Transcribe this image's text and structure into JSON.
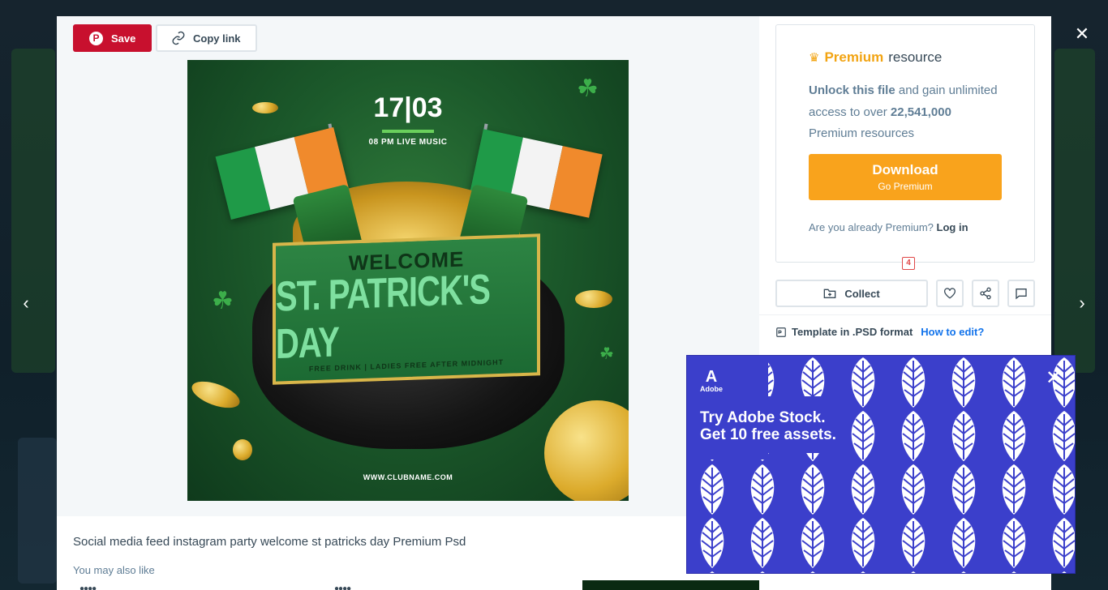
{
  "nav": {
    "prev_icon": "‹",
    "next_icon": "›",
    "close_icon": "✕"
  },
  "toolbar": {
    "save_label": "Save",
    "pin_glyph": "P",
    "copy_label": "Copy link"
  },
  "preview": {
    "date": "17|03",
    "time": "08 PM LIVE MUSIC",
    "welcome": "WELCOME",
    "title": "ST. PATRICK'S DAY",
    "subtitle": "FREE DRINK | LADIES FREE AFTER MIDNIGHT",
    "website": "WWW.CLUBNAME.COM"
  },
  "caption": "Social media feed instagram party welcome st patricks day Premium Psd",
  "also_like": "You may also like",
  "premium": {
    "crown_icon": "♛",
    "prem_word": "Premium",
    "resource_word": "resource",
    "unlock_bold": "Unlock this file",
    "unlock_rest": "and gain unlimited access to over",
    "count": "22,541,000",
    "count_rest": "Premium resources",
    "download_label": "Download",
    "download_sub": "Go Premium",
    "already_text": "Are you already Premium?",
    "login_label": "Log in"
  },
  "actions": {
    "collect_label": "Collect",
    "like_count": "4"
  },
  "template": {
    "label": "Template in .PSD format",
    "how_to": "How to edit?"
  },
  "ad": {
    "brand": "Adobe",
    "logo_glyph": "A",
    "line1": "Try Adobe Stock.",
    "line2": "Get 10 free assets.",
    "close_icon": "✕"
  },
  "colors": {
    "save": "#c8102e",
    "premium": "#f2a413",
    "download": "#f9a31c",
    "link": "#1273eb",
    "ad_bg": "#3b3fcb"
  }
}
